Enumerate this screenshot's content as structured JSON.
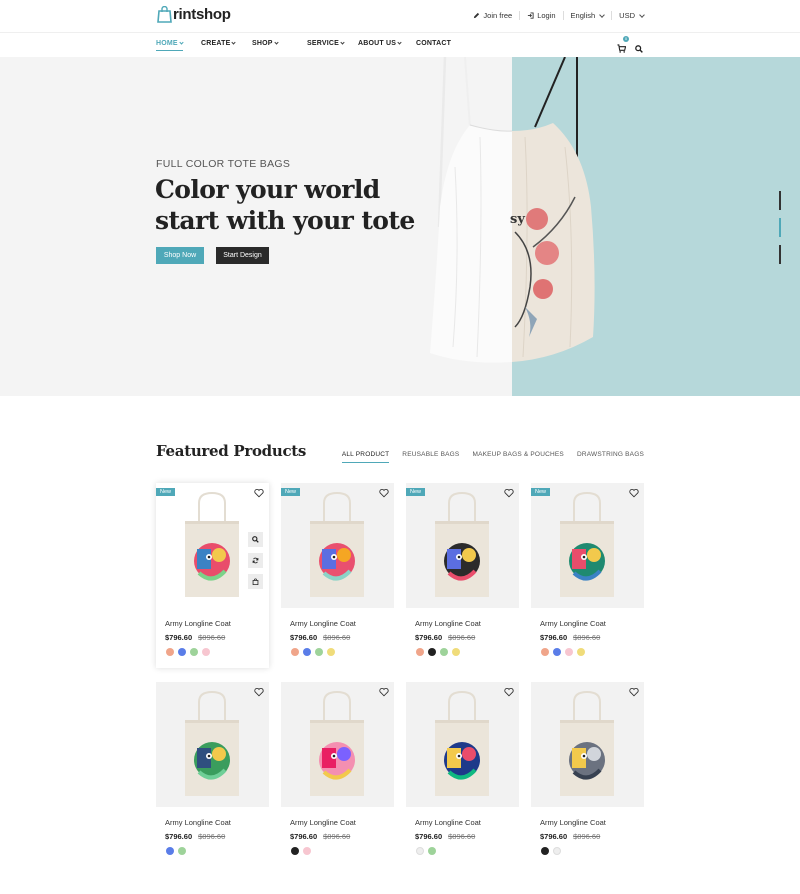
{
  "brand": {
    "logo_text": "rintshop",
    "accent": "#4fa8b8"
  },
  "topbar": {
    "join_label": "Join free",
    "login_label": "Login",
    "language": "English",
    "currency": "USD"
  },
  "nav": {
    "items": [
      {
        "label": "HOME",
        "has_caret": true,
        "active": true
      },
      {
        "label": "CREATE",
        "has_caret": true
      },
      {
        "label": "SHOP",
        "has_caret": true
      },
      {
        "label": "SERVICE",
        "has_caret": true
      },
      {
        "label": "ABOUT US",
        "has_caret": true
      },
      {
        "label": "CONTACT",
        "has_caret": false
      }
    ],
    "cart_count": "0"
  },
  "hero": {
    "subtitle": "FULL COLOR TOTE BAGS",
    "title_line1": "Color your world",
    "title_line2": "start with your tote",
    "shop_button": "Shop Now",
    "design_button": "Start Design",
    "bag_print_text": "sy"
  },
  "featured": {
    "title": "Featured Products",
    "filters": [
      "ALL PRODUCT",
      "REUSABLE BAGS",
      "MAKEUP BAGS & POUCHES",
      "DRAWSTRING BAGS"
    ],
    "products": [
      {
        "name": "Army Longline Coat",
        "price": "$796.60",
        "old_price": "$896.60",
        "is_new": true,
        "badge": "New",
        "swatches": [
          "#f0a58a",
          "#5a7de8",
          "#9ed39a",
          "#f7c6d0"
        ]
      },
      {
        "name": "Army Longline Coat",
        "price": "$796.60",
        "old_price": "$896.60",
        "is_new": true,
        "badge": "New",
        "swatches": [
          "#f0a58a",
          "#5a7de8",
          "#9ed39a",
          "#f0dc7a"
        ]
      },
      {
        "name": "Army Longline Coat",
        "price": "$796.60",
        "old_price": "$896.60",
        "is_new": true,
        "badge": "New",
        "swatches": [
          "#f0a58a",
          "#222222",
          "#9ed39a",
          "#f0dc7a"
        ]
      },
      {
        "name": "Army Longline Coat",
        "price": "$796.60",
        "old_price": "$896.60",
        "is_new": true,
        "badge": "New",
        "swatches": [
          "#f0a58a",
          "#5a7de8",
          "#f7c6d0",
          "#f0dc7a"
        ]
      },
      {
        "name": "Army Longline Coat",
        "price": "$796.60",
        "old_price": "$896.60",
        "is_new": false,
        "swatches": [
          "#5a7de8",
          "#9ed39a"
        ]
      },
      {
        "name": "Army Longline Coat",
        "price": "$796.60",
        "old_price": "$896.60",
        "is_new": false,
        "swatches": [
          "#222222",
          "#f7c6d0"
        ]
      },
      {
        "name": "Army Longline Coat",
        "price": "$796.60",
        "old_price": "$896.60",
        "is_new": false,
        "swatches": [
          "#eeeeee",
          "#9ed39a"
        ]
      },
      {
        "name": "Army Longline Coat",
        "price": "$796.60",
        "old_price": "$896.60",
        "is_new": false,
        "swatches": [
          "#222222",
          "#eeeeee"
        ]
      }
    ]
  }
}
